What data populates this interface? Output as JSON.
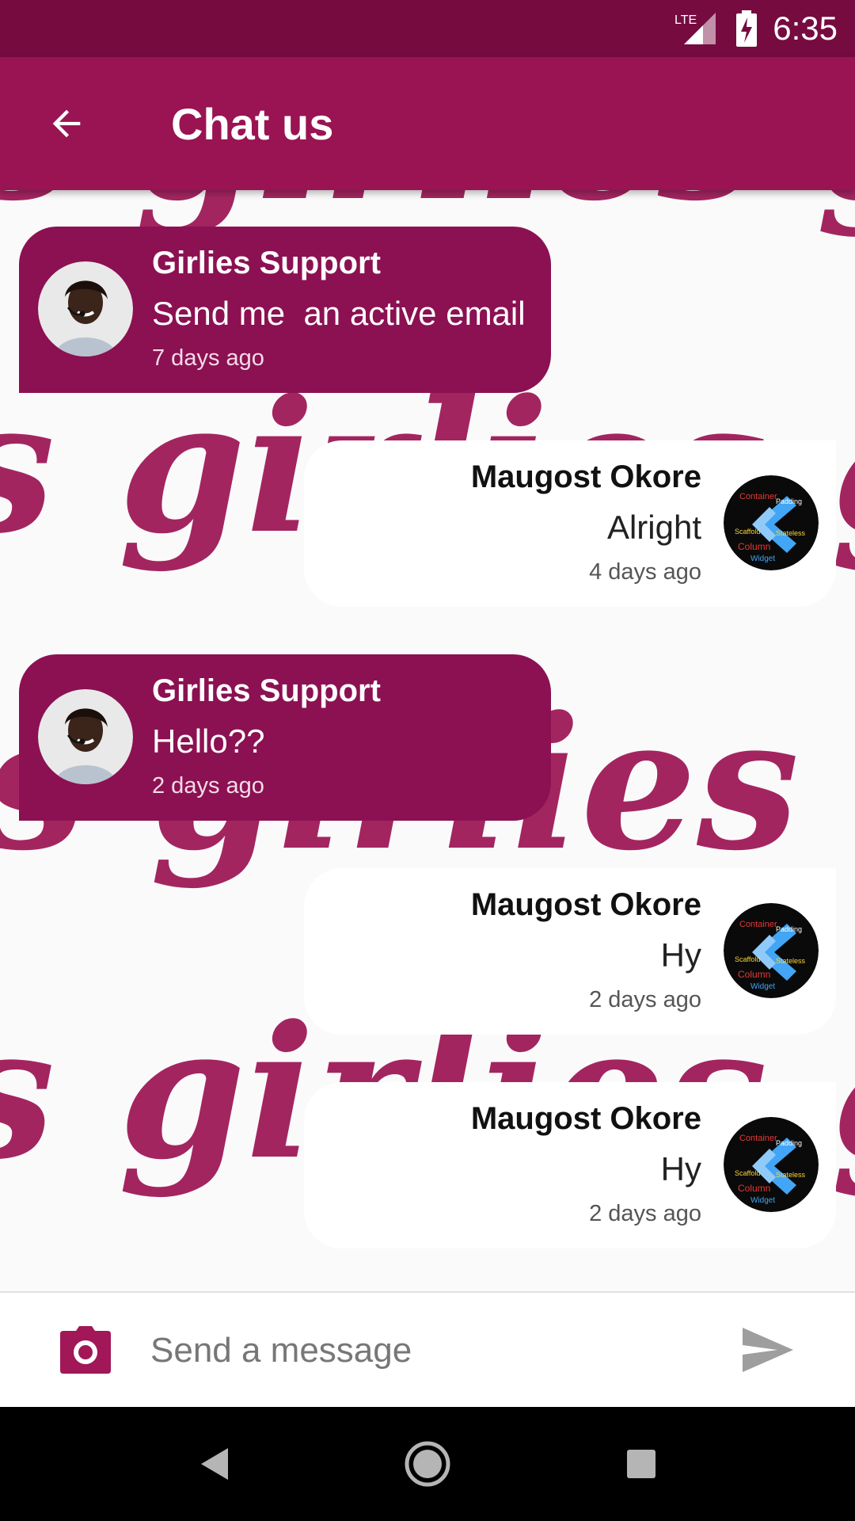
{
  "status_bar": {
    "network": "LTE",
    "time": "6:35",
    "icons": [
      "lte-signal-icon",
      "battery-charging-icon"
    ]
  },
  "app_bar": {
    "title": "Chat us",
    "back_icon": "arrow-back-icon"
  },
  "messages": [
    {
      "side": "support",
      "sender": "Girlies Support",
      "text": "Send me  an active email",
      "time": "7 days ago"
    },
    {
      "side": "user",
      "sender": "Maugost Okore",
      "text": "Alright",
      "time": "4 days ago"
    },
    {
      "side": "support",
      "sender": "Girlies Support",
      "text": "Hello??",
      "time": "2 days ago"
    },
    {
      "side": "user",
      "sender": "Maugost Okore",
      "text": "Hy",
      "time": "2 days ago"
    },
    {
      "side": "user",
      "sender": "Maugost Okore",
      "text": "Hy",
      "time": "2 days ago"
    }
  ],
  "composer": {
    "placeholder": "Send a message",
    "value": "",
    "camera_icon": "camera-icon",
    "send_icon": "send-icon"
  },
  "nav_bar": {
    "icons": [
      "nav-back-icon",
      "nav-home-icon",
      "nav-recents-icon"
    ]
  },
  "colors": {
    "status_bar": "#760b40",
    "app_bar": "#9a1352",
    "support_bubble": "#8b1152",
    "user_bubble": "#ffffff",
    "wallpaper_text": "#9c1454",
    "accent": "#a11758"
  }
}
